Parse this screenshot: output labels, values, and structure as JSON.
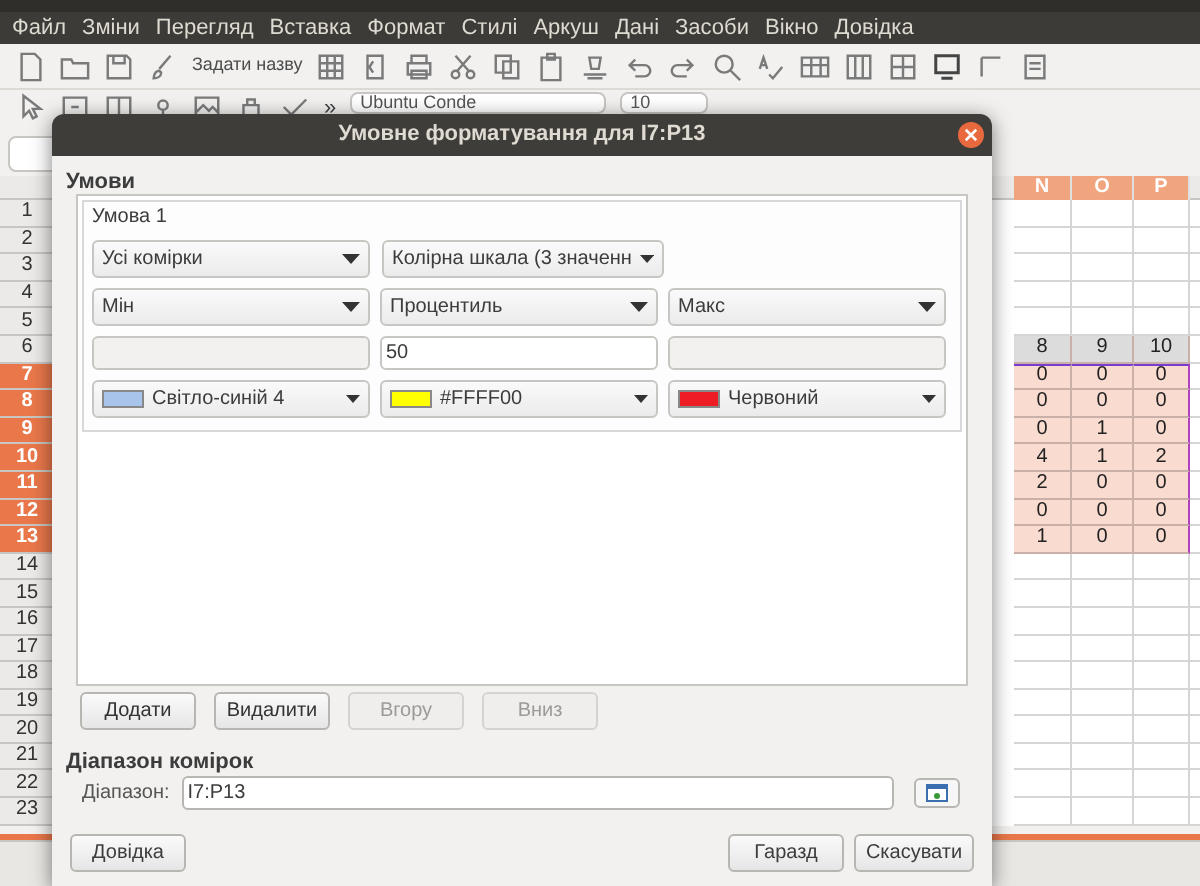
{
  "menu": [
    "Файл",
    "Зміни",
    "Перегляд",
    "Вставка",
    "Формат",
    "Стилі",
    "Аркуш",
    "Дані",
    "Засоби",
    "Вікно",
    "Довідка"
  ],
  "toolbar": {
    "name_button": "Задати назву",
    "overflow": "»",
    "font": "Ubuntu Conde",
    "size": "10"
  },
  "sheet": {
    "columns": [
      "N",
      "O",
      "P"
    ],
    "rows": [
      {
        "number": "1",
        "selected": false,
        "kind": "plain"
      },
      {
        "number": "2",
        "selected": false,
        "kind": "plain"
      },
      {
        "number": "3",
        "selected": false,
        "kind": "plain"
      },
      {
        "number": "4",
        "selected": false,
        "kind": "plain"
      },
      {
        "number": "5",
        "selected": false,
        "kind": "plain"
      },
      {
        "number": "6",
        "selected": false,
        "kind": "heading",
        "cells": [
          "8",
          "9",
          "10"
        ]
      },
      {
        "number": "7",
        "selected": true,
        "kind": "data",
        "cells": [
          "0",
          "0",
          "0"
        ]
      },
      {
        "number": "8",
        "selected": true,
        "kind": "data",
        "cells": [
          "0",
          "0",
          "0"
        ]
      },
      {
        "number": "9",
        "selected": true,
        "kind": "data",
        "cells": [
          "0",
          "1",
          "0"
        ]
      },
      {
        "number": "10",
        "selected": true,
        "kind": "data",
        "cells": [
          "4",
          "1",
          "2"
        ]
      },
      {
        "number": "11",
        "selected": true,
        "kind": "data",
        "cells": [
          "2",
          "0",
          "0"
        ]
      },
      {
        "number": "12",
        "selected": true,
        "kind": "data",
        "cells": [
          "0",
          "0",
          "0"
        ]
      },
      {
        "number": "13",
        "selected": true,
        "kind": "data",
        "cells": [
          "1",
          "0",
          "0"
        ]
      },
      {
        "number": "14",
        "selected": false,
        "kind": "plain"
      },
      {
        "number": "15",
        "selected": false,
        "kind": "plain"
      },
      {
        "number": "16",
        "selected": false,
        "kind": "plain"
      },
      {
        "number": "17",
        "selected": false,
        "kind": "plain"
      },
      {
        "number": "18",
        "selected": false,
        "kind": "plain"
      },
      {
        "number": "19",
        "selected": false,
        "kind": "plain"
      },
      {
        "number": "20",
        "selected": false,
        "kind": "plain"
      },
      {
        "number": "21",
        "selected": false,
        "kind": "plain"
      },
      {
        "number": "22",
        "selected": false,
        "kind": "plain"
      },
      {
        "number": "23",
        "selected": false,
        "kind": "plain"
      }
    ]
  },
  "dialog": {
    "title": "Умовне форматування для I7:P13",
    "section": "Умови",
    "condition": {
      "title": "Умова 1",
      "scope": "Усі комірки",
      "type": "Колірна шкала (3 значенн",
      "entries": [
        {
          "type": "Мін",
          "color_name": "Світло-синій 4",
          "color": "#a9c4eb"
        },
        {
          "type": "Процентиль",
          "value": "50",
          "color_name": "#FFFF00",
          "color": "#ffff00"
        },
        {
          "type": "Макс",
          "color_name": "Червоний",
          "color": "#ee1c24"
        }
      ]
    },
    "list_buttons": [
      {
        "label": "Додати",
        "disabled": false
      },
      {
        "label": "Видалити",
        "disabled": false
      },
      {
        "label": "Вгору",
        "disabled": true
      },
      {
        "label": "Вниз",
        "disabled": true
      }
    ],
    "range_section": "Діапазон комірок",
    "range_label": "Діапазон:",
    "range_value": "I7:P13",
    "help_button": "Довідка",
    "ok_button": "Гаразд",
    "cancel_button": "Скасувати"
  }
}
